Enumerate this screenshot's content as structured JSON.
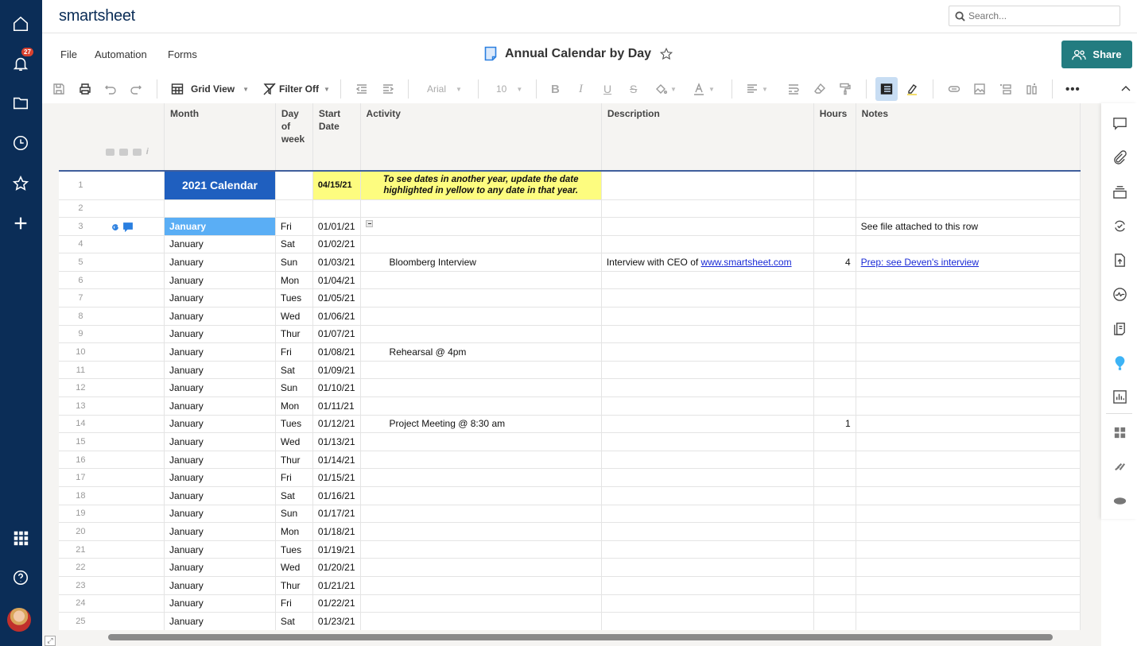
{
  "app": {
    "logo": "smartsheet"
  },
  "leftnav": {
    "notification_count": "27",
    "items": [
      {
        "name": "home",
        "icon": "home-icon"
      },
      {
        "name": "notifications",
        "icon": "bell-icon"
      },
      {
        "name": "browse",
        "icon": "folder-icon"
      },
      {
        "name": "recents",
        "icon": "clock-icon"
      },
      {
        "name": "favorites",
        "icon": "star-icon"
      },
      {
        "name": "create",
        "icon": "plus-icon"
      },
      {
        "name": "launcher",
        "icon": "grid-icon"
      },
      {
        "name": "help",
        "icon": "help-icon"
      },
      {
        "name": "account",
        "icon": "avatar"
      }
    ]
  },
  "header": {
    "search_placeholder": "Search...",
    "menus": [
      "File",
      "Automation",
      "Forms"
    ],
    "sheet_title": "Annual Calendar by Day",
    "share_label": "Share"
  },
  "toolbar": {
    "view_label": "Grid View",
    "filter_label": "Filter Off",
    "font_family": "Arial",
    "font_size": "10"
  },
  "grid": {
    "columns": [
      "Month",
      "Day of week",
      "Start Date",
      "Activity",
      "Description",
      "Hours",
      "Notes"
    ],
    "row1": {
      "month": "2021 Calendar",
      "start_date": "04/15/21",
      "activity": "To see dates in another year, update the date highlighted in yellow to any date in that year."
    },
    "rows": [
      {
        "n": "3",
        "month": "January",
        "day": "Fri",
        "date": "01/01/21",
        "activity": "",
        "description": "",
        "description_link": "",
        "hours": "",
        "notes": "See file attached to this row",
        "notes_link": ""
      },
      {
        "n": "4",
        "month": "January",
        "day": "Sat",
        "date": "01/02/21",
        "activity": "",
        "description": "",
        "description_link": "",
        "hours": "",
        "notes": "",
        "notes_link": ""
      },
      {
        "n": "5",
        "month": "January",
        "day": "Sun",
        "date": "01/03/21",
        "activity": "Bloomberg Interview",
        "description": "Interview with CEO of ",
        "description_link": "www.smartsheet.com",
        "hours": "4",
        "notes": "",
        "notes_link": "Prep: see Deven's interview"
      },
      {
        "n": "6",
        "month": "January",
        "day": "Mon",
        "date": "01/04/21",
        "activity": "",
        "description": "",
        "description_link": "",
        "hours": "",
        "notes": "",
        "notes_link": ""
      },
      {
        "n": "7",
        "month": "January",
        "day": "Tues",
        "date": "01/05/21",
        "activity": "",
        "description": "",
        "description_link": "",
        "hours": "",
        "notes": "",
        "notes_link": ""
      },
      {
        "n": "8",
        "month": "January",
        "day": "Wed",
        "date": "01/06/21",
        "activity": "",
        "description": "",
        "description_link": "",
        "hours": "",
        "notes": "",
        "notes_link": ""
      },
      {
        "n": "9",
        "month": "January",
        "day": "Thur",
        "date": "01/07/21",
        "activity": "",
        "description": "",
        "description_link": "",
        "hours": "",
        "notes": "",
        "notes_link": ""
      },
      {
        "n": "10",
        "month": "January",
        "day": "Fri",
        "date": "01/08/21",
        "activity": "Rehearsal @ 4pm",
        "description": "",
        "description_link": "",
        "hours": "",
        "notes": "",
        "notes_link": ""
      },
      {
        "n": "11",
        "month": "January",
        "day": "Sat",
        "date": "01/09/21",
        "activity": "",
        "description": "",
        "description_link": "",
        "hours": "",
        "notes": "",
        "notes_link": ""
      },
      {
        "n": "12",
        "month": "January",
        "day": "Sun",
        "date": "01/10/21",
        "activity": "",
        "description": "",
        "description_link": "",
        "hours": "",
        "notes": "",
        "notes_link": ""
      },
      {
        "n": "13",
        "month": "January",
        "day": "Mon",
        "date": "01/11/21",
        "activity": "",
        "description": "",
        "description_link": "",
        "hours": "",
        "notes": "",
        "notes_link": ""
      },
      {
        "n": "14",
        "month": "January",
        "day": "Tues",
        "date": "01/12/21",
        "activity": "Project Meeting @ 8:30 am",
        "description": "",
        "description_link": "",
        "hours": "1",
        "notes": "",
        "notes_link": ""
      },
      {
        "n": "15",
        "month": "January",
        "day": "Wed",
        "date": "01/13/21",
        "activity": "",
        "description": "",
        "description_link": "",
        "hours": "",
        "notes": "",
        "notes_link": ""
      },
      {
        "n": "16",
        "month": "January",
        "day": "Thur",
        "date": "01/14/21",
        "activity": "",
        "description": "",
        "description_link": "",
        "hours": "",
        "notes": "",
        "notes_link": ""
      },
      {
        "n": "17",
        "month": "January",
        "day": "Fri",
        "date": "01/15/21",
        "activity": "",
        "description": "",
        "description_link": "",
        "hours": "",
        "notes": "",
        "notes_link": ""
      },
      {
        "n": "18",
        "month": "January",
        "day": "Sat",
        "date": "01/16/21",
        "activity": "",
        "description": "",
        "description_link": "",
        "hours": "",
        "notes": "",
        "notes_link": ""
      },
      {
        "n": "19",
        "month": "January",
        "day": "Sun",
        "date": "01/17/21",
        "activity": "",
        "description": "",
        "description_link": "",
        "hours": "",
        "notes": "",
        "notes_link": ""
      },
      {
        "n": "20",
        "month": "January",
        "day": "Mon",
        "date": "01/18/21",
        "activity": "",
        "description": "",
        "description_link": "",
        "hours": "",
        "notes": "",
        "notes_link": ""
      },
      {
        "n": "21",
        "month": "January",
        "day": "Tues",
        "date": "01/19/21",
        "activity": "",
        "description": "",
        "description_link": "",
        "hours": "",
        "notes": "",
        "notes_link": ""
      },
      {
        "n": "22",
        "month": "January",
        "day": "Wed",
        "date": "01/20/21",
        "activity": "",
        "description": "",
        "description_link": "",
        "hours": "",
        "notes": "",
        "notes_link": ""
      },
      {
        "n": "23",
        "month": "January",
        "day": "Thur",
        "date": "01/21/21",
        "activity": "",
        "description": "",
        "description_link": "",
        "hours": "",
        "notes": "",
        "notes_link": ""
      },
      {
        "n": "24",
        "month": "January",
        "day": "Fri",
        "date": "01/22/21",
        "activity": "",
        "description": "",
        "description_link": "",
        "hours": "",
        "notes": "",
        "notes_link": ""
      },
      {
        "n": "25",
        "month": "January",
        "day": "Sat",
        "date": "01/23/21",
        "activity": "",
        "description": "",
        "description_link": "",
        "hours": "",
        "notes": "",
        "notes_link": ""
      }
    ]
  },
  "rightpanel": [
    "comments",
    "attachments",
    "proofs",
    "update-requests",
    "publish",
    "activity-log",
    "summary",
    "dynamic-view",
    "reports",
    "apps",
    "connectors",
    "salesforce"
  ],
  "colors": {
    "nav": "#0b2d57",
    "share": "#237c80",
    "calendar_title": "#1f5fbf",
    "highlight_yellow": "#fdfc7f",
    "january_highlight": "#5aaef5",
    "link": "#1a2ad6"
  }
}
